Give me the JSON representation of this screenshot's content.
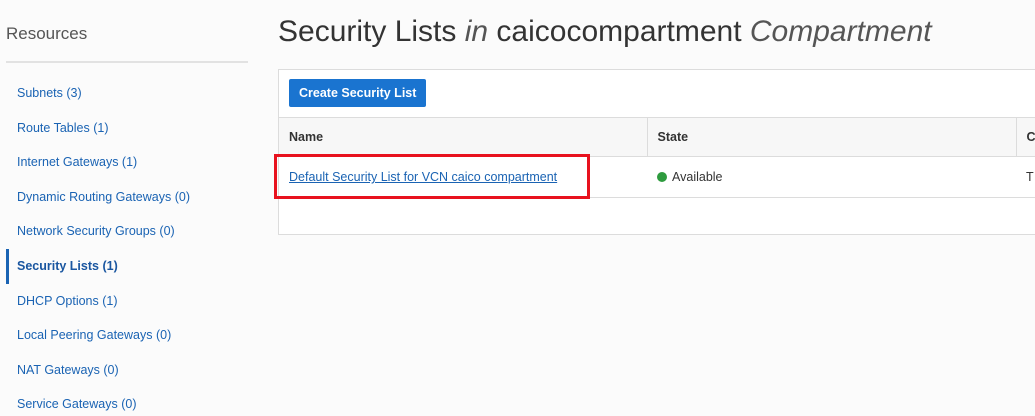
{
  "sidebar": {
    "title": "Resources",
    "items": [
      {
        "label": "Subnets (3)"
      },
      {
        "label": "Route Tables (1)"
      },
      {
        "label": "Internet Gateways (1)"
      },
      {
        "label": "Dynamic Routing Gateways (0)"
      },
      {
        "label": "Network Security Groups (0)"
      },
      {
        "label": "Security Lists (1)",
        "active": true
      },
      {
        "label": "DHCP Options (1)"
      },
      {
        "label": "Local Peering Gateways (0)"
      },
      {
        "label": "NAT Gateways (0)"
      },
      {
        "label": "Service Gateways (0)"
      }
    ]
  },
  "header": {
    "title_part1": "Security Lists ",
    "title_in": "in",
    "title_compartment": " caicocompartment ",
    "title_suffix": "Compartment"
  },
  "toolbar": {
    "create_label": "Create Security List"
  },
  "table": {
    "columns": [
      "Name",
      "State",
      "C"
    ],
    "rows": [
      {
        "name": "Default Security List for VCN caico compartment",
        "state": "Available",
        "extra": "T"
      }
    ]
  },
  "colors": {
    "accent": "#1a74d0",
    "link": "#1a63b3",
    "status_available": "#2e9b3e",
    "highlight": "#e8121e"
  },
  "icons": {
    "status": "status-dot-icon"
  }
}
